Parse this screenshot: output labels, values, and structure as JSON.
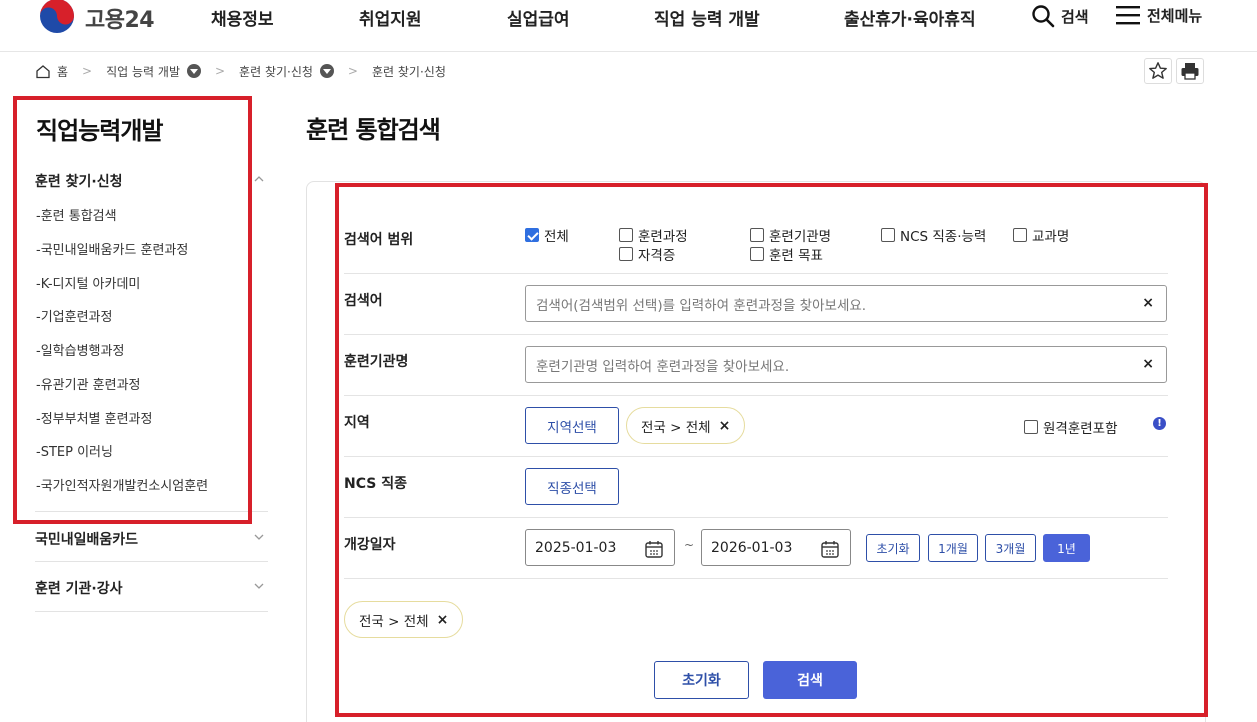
{
  "header": {
    "logo_text": "고용24",
    "nav": [
      "채용정보",
      "취업지원",
      "실업급여",
      "직업 능력 개발",
      "출산휴가·육아휴직"
    ],
    "search_label": "검색",
    "menu_label": "전체메뉴"
  },
  "breadcrumb": {
    "home": "홈",
    "level1": "직업 능력 개발",
    "level2": "훈련 찾기·신청",
    "level3": "훈련 찾기·신청"
  },
  "sidebar": {
    "title": "직업능력개발",
    "group1": "훈련 찾기·신청",
    "items": [
      "-훈련 통합검색",
      "-국민내일배움카드 훈련과정",
      "-K-디지털 아카데미",
      "-기업훈련과정",
      "-일학습병행과정",
      "-유관기관 훈련과정",
      "-정부부처별 훈련과정",
      "-STEP 이러닝",
      "-국가인적자원개발컨소시엄훈련"
    ],
    "group2": "국민내일배움카드",
    "group3": "훈련 기관·강사"
  },
  "main": {
    "title": "훈련 통합검색",
    "scope_label": "검색어 범위",
    "scope_options": [
      "전체",
      "훈련과정",
      "훈련기관명",
      "NCS 직종·능력",
      "교과명",
      "자격증",
      "훈련 목표"
    ],
    "keyword_label": "검색어",
    "keyword_placeholder": "검색어(검색범위 선택)를 입력하여 훈련과정을 찾아보세요.",
    "org_label": "훈련기관명",
    "org_placeholder": "훈련기관명 입력하여 훈련과정을 찾아보세요.",
    "region_label": "지역",
    "region_button": "지역선택",
    "region_chip": "전국 > 전체",
    "remote_label": "원격훈련포함",
    "ncs_label": "NCS 직종",
    "ncs_button": "직종선택",
    "date_label": "개강일자",
    "date_from": "2025-01-03",
    "date_to": "2026-01-03",
    "date_sep": "~",
    "period_buttons": [
      "초기화",
      "1개월",
      "3개월",
      "1년"
    ],
    "selected_chip": "전국 > 전체",
    "reset_button": "초기화",
    "search_button": "검색",
    "clear_symbol": "×",
    "info_symbol": "!"
  },
  "colors": {
    "accent": "#4a63d9",
    "outline": "#2e4fa8",
    "highlight": "#d7202a"
  }
}
